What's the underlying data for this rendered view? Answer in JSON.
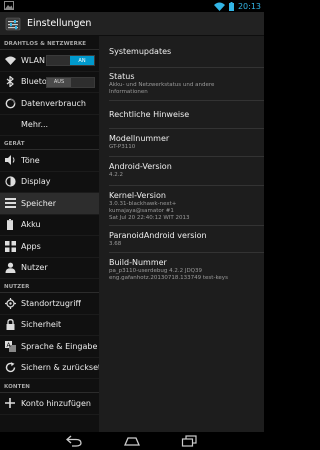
{
  "status_bar": {
    "time": "20:13",
    "wifi_icon": "wifi-icon",
    "battery_icon": "battery-icon",
    "notification_icon": "image-notification-icon"
  },
  "action_bar": {
    "title": "Einstellungen",
    "app_icon": "settings-icon"
  },
  "colors": {
    "accent": "#33b5e5",
    "toggle_on": "#0099cc",
    "sidebar_bg": "#101010",
    "detail_bg": "#1d1d1d"
  },
  "sidebar": {
    "sections": [
      {
        "header": "DRAHTLOS & NETZWERKE",
        "items": [
          {
            "label": "WLAN",
            "icon": "wifi-icon",
            "toggle": "AN"
          },
          {
            "label": "Bluetooth",
            "icon": "bluetooth-icon",
            "toggle": "AUS"
          },
          {
            "label": "Datenverbrauch",
            "icon": "data-usage-icon"
          },
          {
            "label": "Mehr...",
            "icon": ""
          }
        ]
      },
      {
        "header": "GERÄT",
        "items": [
          {
            "label": "Töne",
            "icon": "speaker-icon"
          },
          {
            "label": "Display",
            "icon": "display-icon"
          },
          {
            "label": "Speicher",
            "icon": "storage-icon"
          },
          {
            "label": "Akku",
            "icon": "battery-icon"
          },
          {
            "label": "Apps",
            "icon": "apps-icon"
          },
          {
            "label": "Nutzer",
            "icon": "user-icon"
          }
        ]
      },
      {
        "header": "NUTZER",
        "items": [
          {
            "label": "Standortzugriff",
            "icon": "location-icon"
          },
          {
            "label": "Sicherheit",
            "icon": "lock-icon"
          },
          {
            "label": "Sprache & Eingabe",
            "icon": "language-icon"
          },
          {
            "label": "Sichern & zurücksetzen",
            "icon": "backup-icon"
          }
        ]
      },
      {
        "header": "KONTEN",
        "items": [
          {
            "label": "Konto hinzufügen",
            "icon": "add-icon"
          }
        ]
      }
    ]
  },
  "detail": {
    "entries": [
      {
        "title": "Systemupdates",
        "subtitle": []
      },
      {
        "title": "Status",
        "subtitle": [
          "Akku- und Netzwerkstatus und andere",
          "Informationen"
        ]
      },
      {
        "title": "Rechtliche Hinweise",
        "subtitle": []
      },
      {
        "title": "Modellnummer",
        "subtitle": [
          "GT-P3110"
        ]
      },
      {
        "title": "Android-Version",
        "subtitle": [
          "4.2.2"
        ]
      },
      {
        "title": "Kernel-Version",
        "subtitle": [
          "3.0.31-blackhawk-next+",
          "kumajaya@samator #1",
          "Sat Jul 20 22:40:12 WIT 2013"
        ]
      },
      {
        "title": "ParanoidAndroid version",
        "subtitle": [
          "3.68"
        ]
      },
      {
        "title": "Build-Nummer",
        "subtitle": [
          "pa_p3110-userdebug 4.2.2 JDQ39",
          "eng.gafanhotz.20130718.133749 test-keys"
        ]
      }
    ]
  },
  "nav_bar": {
    "back": "back-icon",
    "home": "home-icon",
    "recents": "recents-icon"
  }
}
